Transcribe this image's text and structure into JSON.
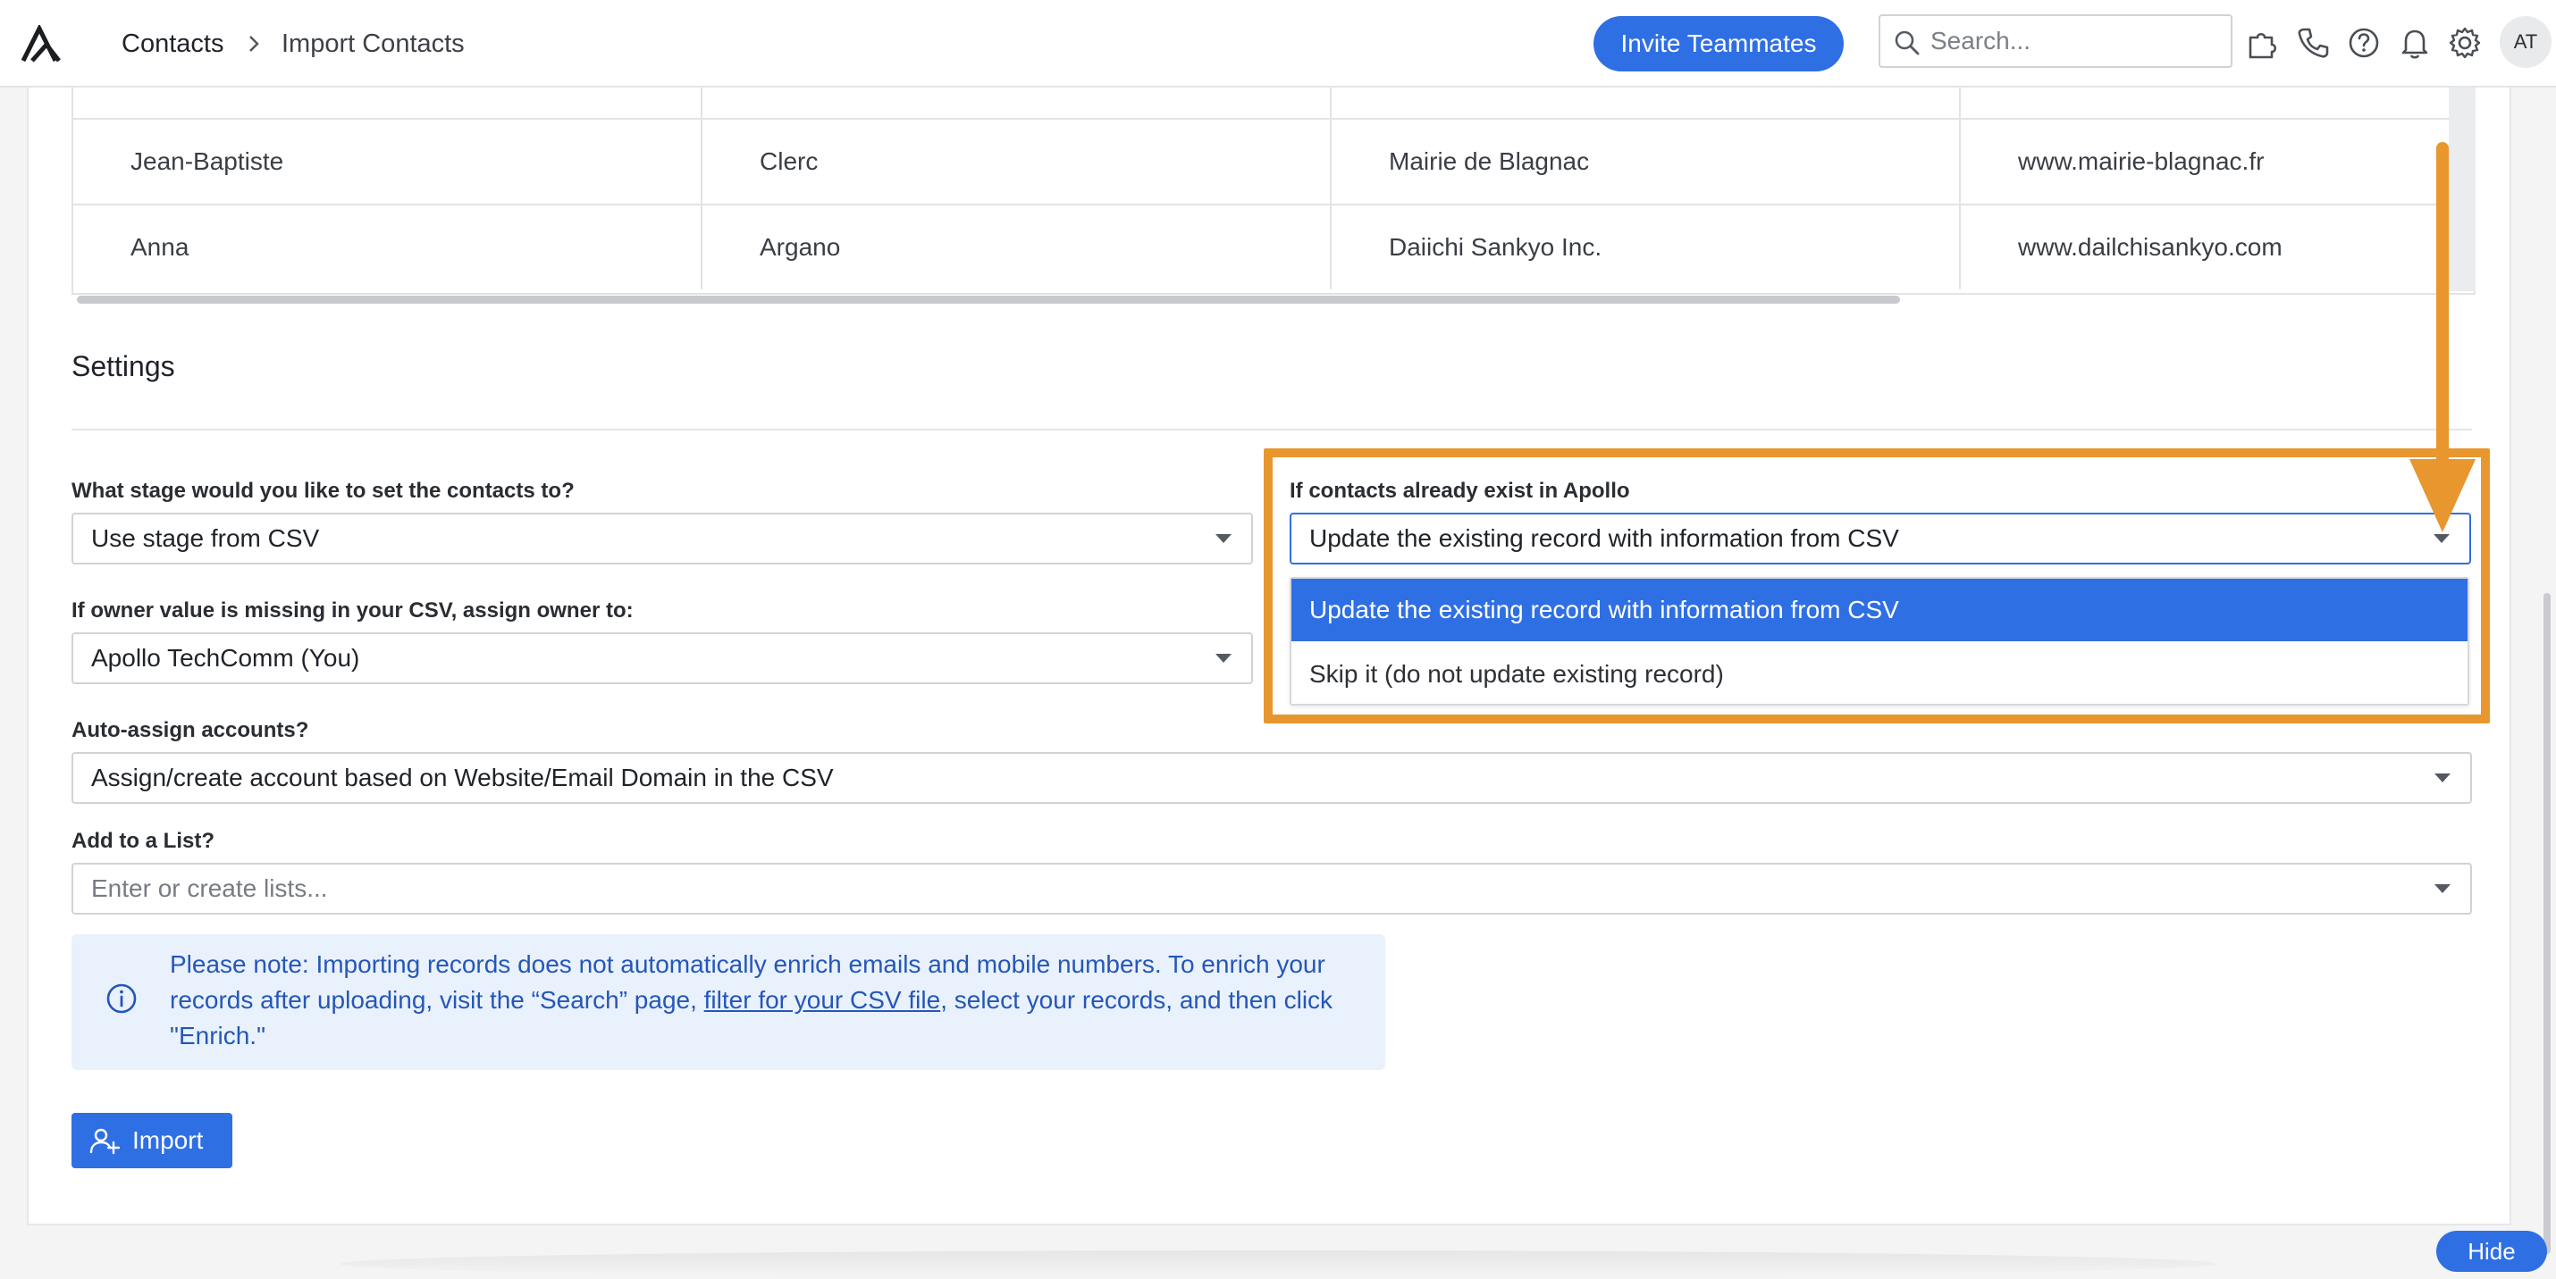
{
  "header": {
    "breadcrumb": [
      "Contacts",
      "Import Contacts"
    ],
    "invite_label": "Invite Teammates",
    "search_placeholder": "Search...",
    "avatar_initials": "AT"
  },
  "table": {
    "rows": [
      [
        "Jean-Baptiste",
        "Clerc",
        "Mairie de Blagnac",
        "www.mairie-blagnac.fr"
      ],
      [
        "Anna",
        "Argano",
        "Daiichi Sankyo Inc.",
        "www.dailchisankyo.com"
      ]
    ]
  },
  "settings": {
    "title": "Settings",
    "stage": {
      "label": "What stage would you like to set the contacts to?",
      "value": "Use stage from CSV"
    },
    "existing": {
      "label": "If contacts already exist in Apollo",
      "value": "Update the existing record with information from CSV",
      "options": [
        "Update the existing record with information from CSV",
        "Skip it (do not update existing record)"
      ]
    },
    "owner": {
      "label": "If owner value is missing in your CSV, assign owner to:",
      "value": "Apollo TechComm (You)"
    },
    "accounts": {
      "label": "Auto-assign accounts?",
      "value": "Assign/create account based on Website/Email Domain in the CSV"
    },
    "list": {
      "label": "Add to a List?",
      "placeholder": "Enter or create lists..."
    }
  },
  "note": {
    "part1": "Please note: Importing records does not automatically enrich emails and mobile numbers. To enrich your records after uploading, visit the “Search” page, ",
    "link": "filter for your CSV file",
    "part2": ", select your records, and then click \"Enrich.\""
  },
  "import_label": "Import",
  "hide_label": "Hide",
  "colors": {
    "primary": "#2f6fe4",
    "highlight": "#e8962e",
    "note_bg": "#e9f1fd"
  }
}
